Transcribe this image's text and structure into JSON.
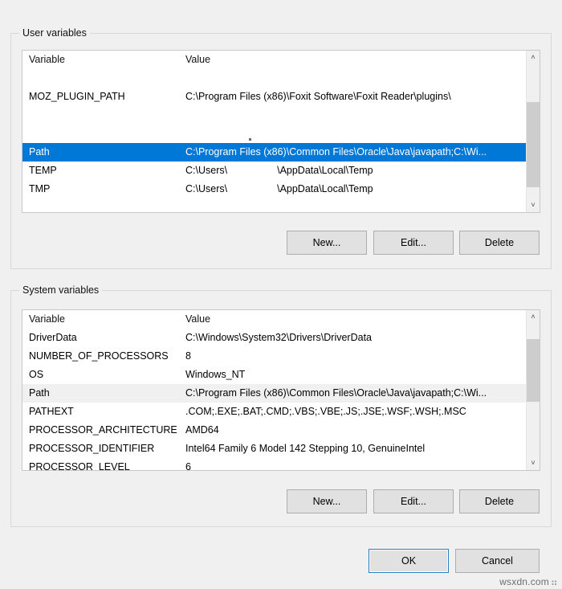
{
  "user_section": {
    "title": "User variables",
    "columns": {
      "variable": "Variable",
      "value": "Value"
    },
    "rows": [
      {
        "name": "",
        "value": "",
        "state": "blank"
      },
      {
        "name": "MOZ_PLUGIN_PATH",
        "value": "C:\\Program Files (x86)\\Foxit Software\\Foxit Reader\\plugins\\",
        "state": "normal"
      },
      {
        "name": "",
        "value": "",
        "state": "blank"
      },
      {
        "name": "",
        "value": "",
        "state": "blank"
      },
      {
        "name": "Path",
        "value": "C:\\Program Files (x86)\\Common Files\\Oracle\\Java\\javapath;C:\\Wi...",
        "state": "selected"
      },
      {
        "name": "TEMP",
        "value_prefix": "C:\\Users\\",
        "value_suffix": "\\AppData\\Local\\Temp",
        "redacted": true,
        "state": "normal"
      },
      {
        "name": "TMP",
        "value_prefix": "C:\\Users\\",
        "value_suffix": "\\AppData\\Local\\Temp",
        "redacted": true,
        "state": "normal"
      }
    ],
    "buttons": {
      "new": "New...",
      "edit": "Edit...",
      "delete": "Delete"
    }
  },
  "system_section": {
    "title": "System variables",
    "columns": {
      "variable": "Variable",
      "value": "Value"
    },
    "rows": [
      {
        "name": "DriverData",
        "value": "C:\\Windows\\System32\\Drivers\\DriverData",
        "state": "normal"
      },
      {
        "name": "NUMBER_OF_PROCESSORS",
        "value": "8",
        "state": "normal"
      },
      {
        "name": "OS",
        "value": "Windows_NT",
        "state": "normal"
      },
      {
        "name": "Path",
        "value": "C:\\Program Files (x86)\\Common Files\\Oracle\\Java\\javapath;C:\\Wi...",
        "state": "selected-inactive"
      },
      {
        "name": "PATHEXT",
        "value": ".COM;.EXE;.BAT;.CMD;.VBS;.VBE;.JS;.JSE;.WSF;.WSH;.MSC",
        "state": "normal"
      },
      {
        "name": "PROCESSOR_ARCHITECTURE",
        "value": "AMD64",
        "state": "normal"
      },
      {
        "name": "PROCESSOR_IDENTIFIER",
        "value": "Intel64 Family 6 Model 142 Stepping 10, GenuineIntel",
        "state": "normal"
      },
      {
        "name": "PROCESSOR_LEVEL",
        "value": "6",
        "state": "normal"
      }
    ],
    "buttons": {
      "new": "New...",
      "edit": "Edit...",
      "delete": "Delete"
    }
  },
  "dialog_buttons": {
    "ok": "OK",
    "cancel": "Cancel"
  },
  "watermark": {
    "text": "wsxdn.com"
  },
  "icons": {
    "scroll_up": "˄",
    "scroll_down": "˅"
  },
  "colors": {
    "selection": "#0078d7",
    "selection_inactive": "#f0f0f0",
    "dialog_background": "#f0f0f0",
    "list_background": "#ffffff",
    "default_button_border": "#2a7fbe"
  }
}
